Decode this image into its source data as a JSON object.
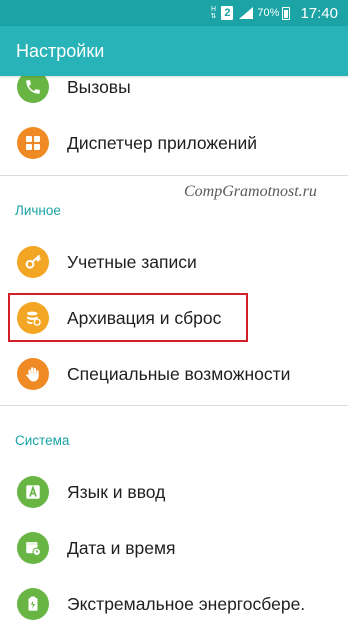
{
  "status_bar": {
    "network_top": "H",
    "network_bottom": "⇅",
    "sim_label": "2",
    "battery_percent": "70%",
    "battery_level": 0.7,
    "time": "17:40"
  },
  "app_bar": {
    "title": "Настройки"
  },
  "watermark": "CompGramotnost.ru",
  "sections": {
    "top_items": [
      {
        "label": "Вызовы",
        "icon": "phone-icon",
        "color": "#68b544"
      },
      {
        "label": "Диспетчер приложений",
        "icon": "apps-grid-icon",
        "color": "#f08a24"
      }
    ],
    "personal": {
      "header": "Личное",
      "items": [
        {
          "label": "Учетные записи",
          "icon": "key-icon",
          "color": "#f3a623"
        },
        {
          "label": "Архивация и сброс",
          "icon": "backup-reset-icon",
          "color": "#f3a623",
          "highlighted": true
        },
        {
          "label": "Специальные возможности",
          "icon": "hand-icon",
          "color": "#f08a24"
        }
      ]
    },
    "system": {
      "header": "Система",
      "items": [
        {
          "label": "Язык и ввод",
          "icon": "language-icon",
          "color": "#68b544"
        },
        {
          "label": "Дата и время",
          "icon": "calendar-clock-icon",
          "color": "#68b544"
        },
        {
          "label": "Экстремальное энергосбере.",
          "icon": "power-saving-icon",
          "color": "#68b544"
        }
      ]
    }
  },
  "colors": {
    "accent": "#27b3b7",
    "status_bar": "#1ba3a6",
    "highlight_border": "#d31f2a"
  }
}
